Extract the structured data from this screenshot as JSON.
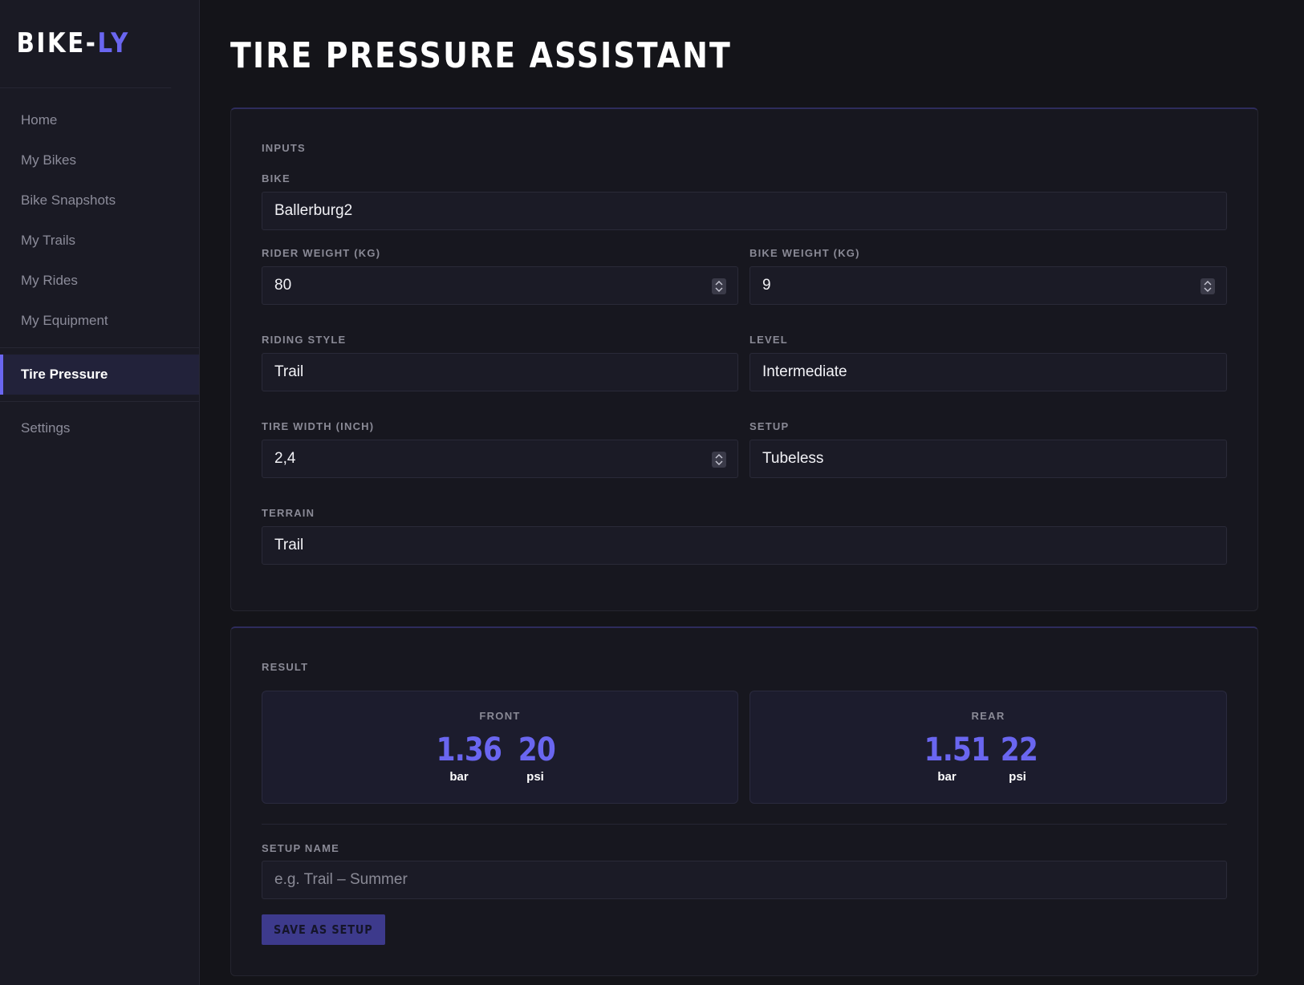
{
  "app": {
    "logo_part1": "BIKE-",
    "logo_part2": "LY",
    "accent_color": "#6a66f0"
  },
  "sidebar": {
    "items": [
      {
        "label": "Home"
      },
      {
        "label": "My Bikes"
      },
      {
        "label": "Bike Snapshots"
      },
      {
        "label": "My Trails"
      },
      {
        "label": "My Rides"
      },
      {
        "label": "My Equipment"
      },
      {
        "label": "Tire Pressure",
        "active": true
      },
      {
        "label": "Settings"
      }
    ]
  },
  "page": {
    "title": "TIRE PRESSURE ASSISTANT"
  },
  "inputs": {
    "section_label": "INPUTS",
    "bike": {
      "label": "BIKE",
      "value": "Ballerburg2"
    },
    "rider_weight": {
      "label": "RIDER WEIGHT (KG)",
      "value": "80"
    },
    "bike_weight": {
      "label": "BIKE WEIGHT (KG)",
      "value": "9"
    },
    "riding_style": {
      "label": "RIDING STYLE",
      "value": "Trail"
    },
    "level": {
      "label": "LEVEL",
      "value": "Intermediate"
    },
    "tire_width": {
      "label": "TIRE WIDTH (INCH)",
      "value": "2,4"
    },
    "setup": {
      "label": "SETUP",
      "value": "Tubeless"
    },
    "terrain": {
      "label": "TERRAIN",
      "value": "Trail"
    }
  },
  "result": {
    "section_label": "RESULT",
    "front": {
      "title": "FRONT",
      "bar": "1.36",
      "bar_unit": "bar",
      "psi": "20",
      "psi_unit": "psi"
    },
    "rear": {
      "title": "REAR",
      "bar": "1.51",
      "bar_unit": "bar",
      "psi": "22",
      "psi_unit": "psi"
    },
    "setup_name": {
      "label": "SETUP NAME",
      "placeholder": "e.g. Trail – Summer"
    },
    "save_label": "SAVE AS SETUP"
  }
}
